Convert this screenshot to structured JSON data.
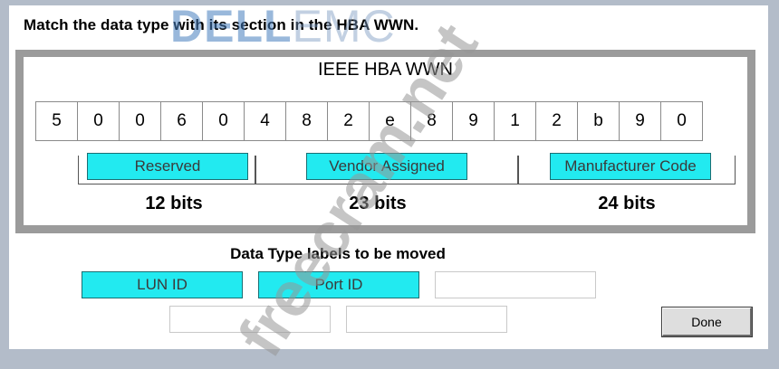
{
  "question": {
    "prompt": "Match the data type with its section in the HBA WWN."
  },
  "wwn_panel": {
    "title": "IEEE HBA WWN",
    "digits": [
      "5",
      "0",
      "0",
      "6",
      "0",
      "4",
      "8",
      "2",
      "e",
      "8",
      "9",
      "1",
      "2",
      "b",
      "9",
      "0"
    ],
    "sections": [
      {
        "target_label": "Reserved",
        "bits": "12 bits"
      },
      {
        "target_label": "Vendor Assigned",
        "bits": "23 bits"
      },
      {
        "target_label": "Manufacturer Code",
        "bits": "24 bits"
      }
    ]
  },
  "label_pool": {
    "heading": "Data Type labels to be moved",
    "labels": [
      "LUN ID",
      "Port ID"
    ]
  },
  "actions": {
    "done_label": "Done"
  },
  "watermarks": {
    "brand": "DELL",
    "brand_suffix": "EMC",
    "site": "freecram.net"
  },
  "colors": {
    "label_fill": "#22eaf0",
    "panel_border": "#9b9b9b",
    "background": "#b3bcc9"
  }
}
